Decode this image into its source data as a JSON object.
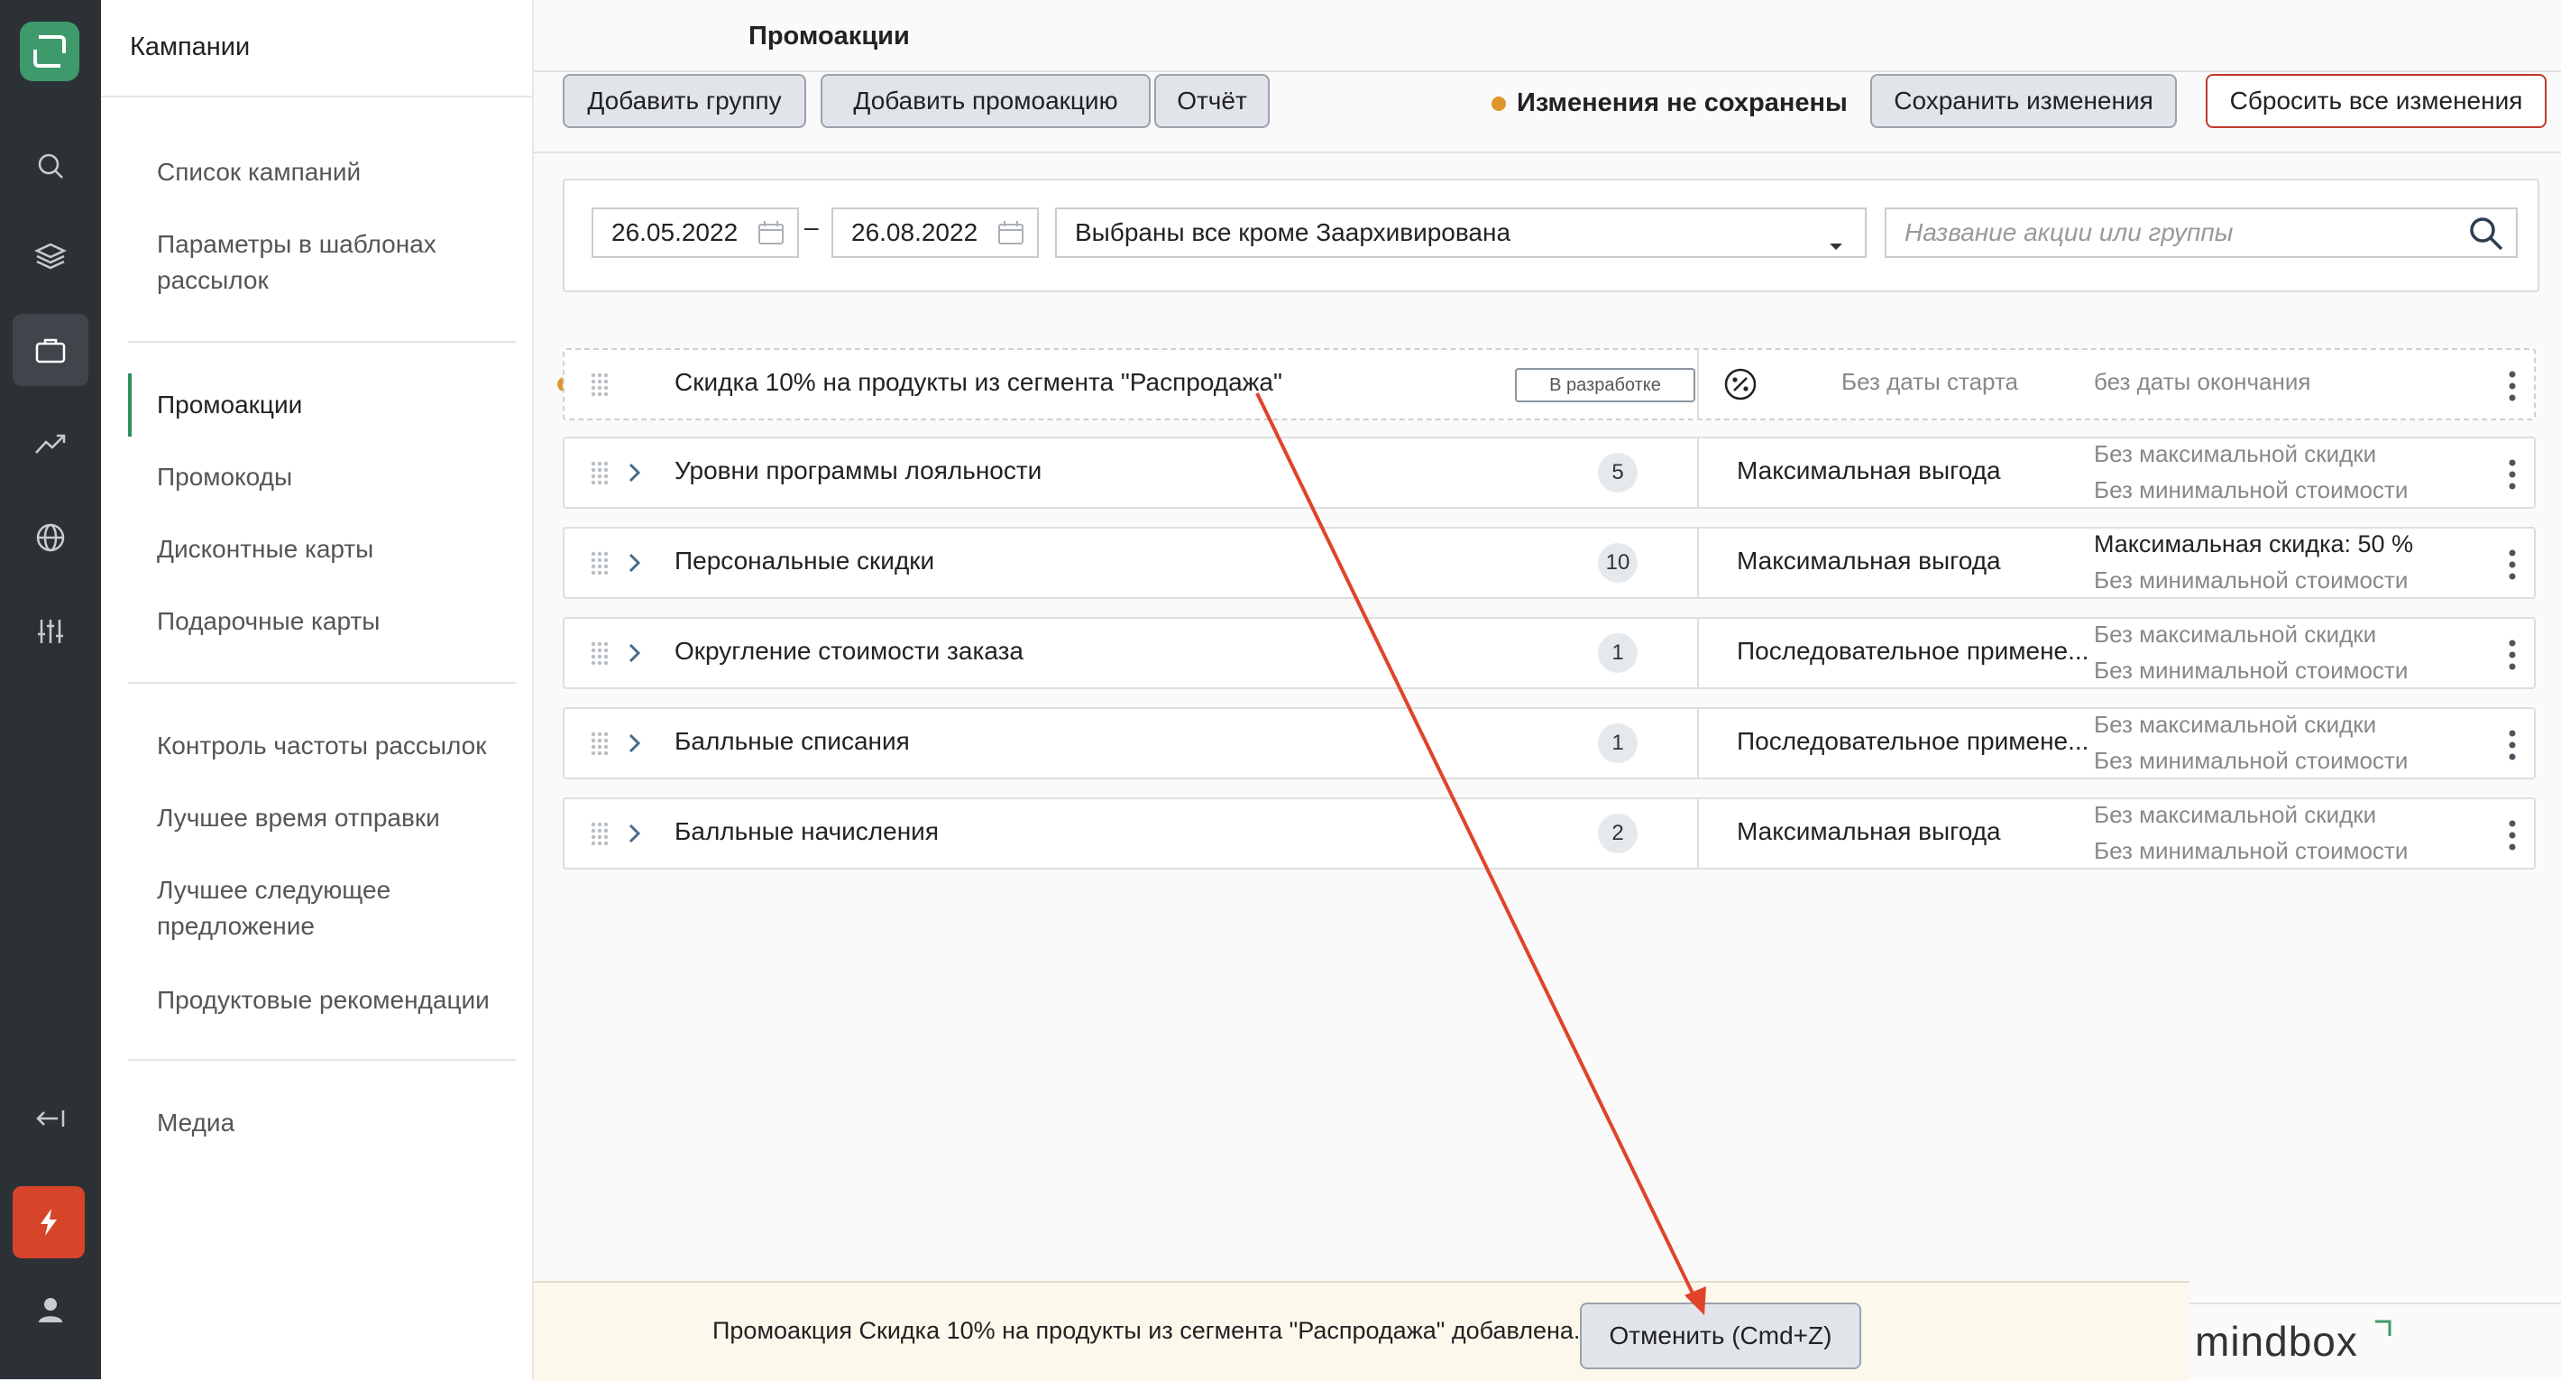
{
  "rail": {
    "icons": [
      "logo-icon",
      "search-icon",
      "layers-icon",
      "briefcase-icon",
      "trend-icon",
      "globe-icon",
      "sliders-icon",
      "collapse-icon",
      "bolt-icon",
      "user-icon"
    ]
  },
  "subnav": {
    "header": "Кампании",
    "items": [
      {
        "label": "Список кампаний"
      },
      {
        "label": "Параметры в шаблонах рассылок"
      },
      {
        "label": "Промоакции"
      },
      {
        "label": "Промокоды"
      },
      {
        "label": "Дисконтные карты"
      },
      {
        "label": "Подарочные карты"
      },
      {
        "label": "Контроль частоты рассылок"
      },
      {
        "label": "Лучшее время отправки"
      },
      {
        "label": "Лучшее следующее предложение"
      },
      {
        "label": "Продуктовые рекомендации"
      },
      {
        "label": "Медиа"
      }
    ]
  },
  "page": {
    "title": "Промоакции"
  },
  "toolbar": {
    "add_group": "Добавить группу",
    "add_promo": "Добавить промоакцию",
    "report": "Отчёт",
    "unsaved": "Изменения не сохранены",
    "save": "Сохранить изменения",
    "reset": "Сбросить все изменения",
    "colors": {
      "unsaved_dot": "#e0962d",
      "reset_border": "#c0392b"
    }
  },
  "filter": {
    "date_from": "26.05.2022",
    "dash": "–",
    "date_to": "26.08.2022",
    "status": "Выбраны все кроме Заархивирована",
    "search_placeholder": "Название акции или группы"
  },
  "promo_row": {
    "name": "Скидка 10% на продукты из сегмента \"Распродажа\"",
    "badge": "В разработке",
    "start": "Без даты старта",
    "end": "без даты окончания"
  },
  "groups": [
    {
      "name": "Уровни программы лояльности",
      "count": "5",
      "mode": "Максимальная выгода",
      "line1": "Без максимальной скидки",
      "line2": "Без минимальной стоимости"
    },
    {
      "name": "Персональные скидки",
      "count": "10",
      "mode": "Максимальная выгода",
      "line1": "Максимальная скидка: 50 %",
      "line2": "Без минимальной стоимости"
    },
    {
      "name": "Округление стоимости заказа",
      "count": "1",
      "mode": "Последовательное примене...",
      "line1": "Без максимальной скидки",
      "line2": "Без минимальной стоимости"
    },
    {
      "name": "Балльные списания",
      "count": "1",
      "mode": "Последовательное примене...",
      "line1": "Без максимальной скидки",
      "line2": "Без минимальной стоимости"
    },
    {
      "name": "Балльные начисления",
      "count": "2",
      "mode": "Максимальная выгода",
      "line1": "Без максимальной скидки",
      "line2": "Без минимальной стоимости"
    }
  ],
  "toast": {
    "message": "Промоакция Скидка 10% на продукты из сегмента \"Распродажа\" добавлена.",
    "undo": "Отменить (Cmd+Z)"
  },
  "brand": "mindbox",
  "annotation": {
    "arrow_color": "#e0432b"
  }
}
